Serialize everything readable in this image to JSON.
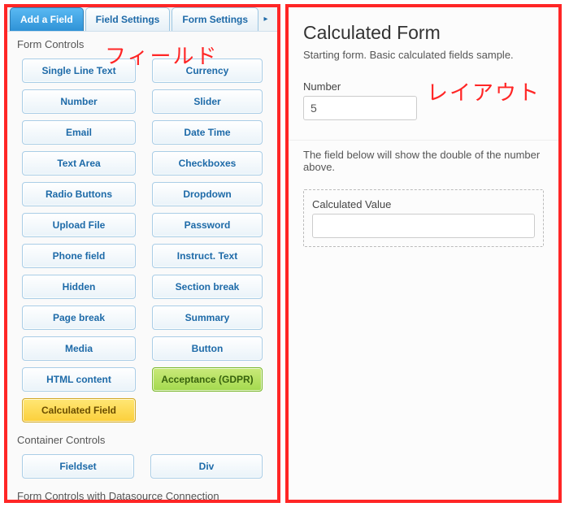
{
  "captions": {
    "left": "フィールド",
    "right": "レイアウト"
  },
  "tabs": {
    "items": [
      "Add a Field",
      "Field Settings",
      "Form Settings"
    ],
    "active_index": 0
  },
  "sections": {
    "form_controls": "Form Controls",
    "container_controls": "Container Controls",
    "datasource": "Form Controls with Datasource Connection"
  },
  "form_fields": [
    [
      "Single Line Text",
      "Currency"
    ],
    [
      "Number",
      "Slider"
    ],
    [
      "Email",
      "Date Time"
    ],
    [
      "Text Area",
      "Checkboxes"
    ],
    [
      "Radio Buttons",
      "Dropdown"
    ],
    [
      "Upload File",
      "Password"
    ],
    [
      "Phone field",
      "Instruct. Text"
    ],
    [
      "Hidden",
      "Section break"
    ],
    [
      "Page break",
      "Summary"
    ],
    [
      "Media",
      "Button"
    ],
    [
      "HTML content",
      "Acceptance (GDPR)"
    ]
  ],
  "calc_field": "Calculated Field",
  "container_fields": [
    [
      "Fieldset",
      "Div"
    ]
  ],
  "preview": {
    "title": "Calculated Form",
    "desc": "Starting form. Basic calculated fields sample.",
    "num_label": "Number",
    "num_value": "5",
    "msg": "The field below will show the double of the number above.",
    "calc_label": "Calculated Value",
    "calc_value": ""
  }
}
